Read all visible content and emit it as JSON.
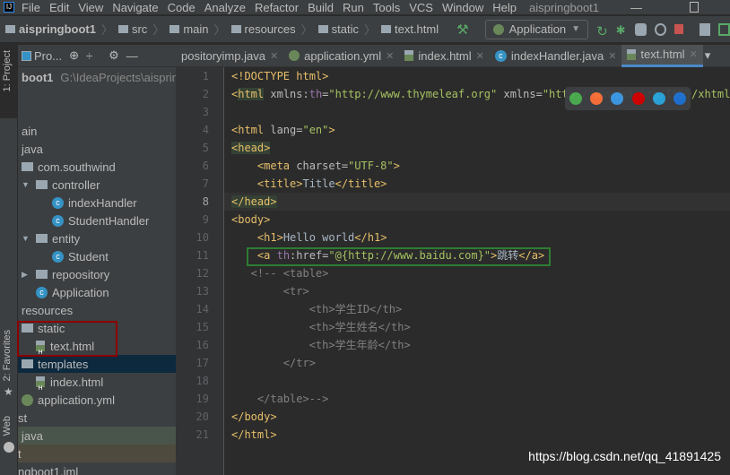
{
  "menubar": {
    "items": [
      "File",
      "Edit",
      "View",
      "Navigate",
      "Code",
      "Analyze",
      "Refactor",
      "Build",
      "Run",
      "Tools",
      "VCS",
      "Window",
      "Help"
    ],
    "title": "aispringboot1"
  },
  "breadcrumb": [
    "aispringboot1",
    "src",
    "main",
    "resources",
    "static",
    "text.html"
  ],
  "run_config": "Application",
  "tabs": [
    {
      "label": "positoryimp.java"
    },
    {
      "label": "application.yml"
    },
    {
      "label": "index.html"
    },
    {
      "label": "indexHandler.java"
    },
    {
      "label": "text.html",
      "active": true
    }
  ],
  "project_panel": {
    "title": "Pro...",
    "path": "G:\\IdeaProjects\\aispring",
    "rows": [
      {
        "label": "boot1",
        "bold": true,
        "indent": 0
      },
      {
        "label": "",
        "indent": 0
      },
      {
        "label": "",
        "indent": 0
      },
      {
        "label": "ain",
        "indent": 0
      },
      {
        "label": "java",
        "indent": 0
      },
      {
        "label": "com.southwind",
        "indent": 0,
        "icon": "package"
      },
      {
        "label": "controller",
        "indent": 1,
        "icon": "package",
        "arrow": "down"
      },
      {
        "label": "indexHandler",
        "indent": 2,
        "icon": "class"
      },
      {
        "label": "StudentHandler",
        "indent": 2,
        "icon": "class"
      },
      {
        "label": "entity",
        "indent": 1,
        "icon": "package",
        "arrow": "down"
      },
      {
        "label": "Student",
        "indent": 2,
        "icon": "class"
      },
      {
        "label": "repoository",
        "indent": 1,
        "icon": "package",
        "arrow": "right"
      },
      {
        "label": "Application",
        "indent": 1,
        "icon": "spring-class"
      },
      {
        "label": "resources",
        "indent": 0
      },
      {
        "label": "static",
        "indent": 0,
        "icon": "folder"
      },
      {
        "label": "text.html",
        "indent": 1,
        "icon": "html"
      },
      {
        "label": "templates",
        "indent": 0,
        "icon": "folder",
        "selected": true
      },
      {
        "label": "index.html",
        "indent": 1,
        "icon": "html"
      },
      {
        "label": "application.yml",
        "indent": 0,
        "icon": "spring"
      },
      {
        "label": "st",
        "indent": -1
      },
      {
        "label": "java",
        "indent": 0,
        "bg": "#49544a"
      },
      {
        "label": "t",
        "indent": -1,
        "bg": "#4e4a3e"
      },
      {
        "label": "ngboot1.iml",
        "indent": -1
      }
    ]
  },
  "side_tabs": {
    "project": "1: Project",
    "favorites": "2: Favorites",
    "web": "Web"
  },
  "editor": {
    "lines": [
      [
        [
          "t",
          "<!DOCTYPE html>"
        ]
      ],
      [
        [
          "t",
          "<"
        ],
        [
          "t hl",
          "html"
        ],
        [
          "a",
          " xmlns:"
        ],
        [
          "n",
          "th"
        ],
        [
          "a",
          "="
        ],
        [
          "s",
          "\"http://www.thymeleaf.org\""
        ],
        [
          "a",
          " xmlns="
        ],
        [
          "s",
          "\"http://www.w3.org/1999/xhtml\""
        ],
        [
          "t",
          ">"
        ]
      ],
      [],
      [
        [
          "t",
          "<html"
        ],
        [
          "a",
          " lang="
        ],
        [
          "s",
          "\"en\""
        ],
        [
          "t",
          ">"
        ]
      ],
      [
        [
          "t hl",
          "<head>"
        ]
      ],
      [
        [
          "x",
          "    "
        ],
        [
          "t",
          "<meta"
        ],
        [
          "a",
          " charset="
        ],
        [
          "s",
          "\"UTF-8\""
        ],
        [
          "t",
          ">"
        ]
      ],
      [
        [
          "x",
          "    "
        ],
        [
          "t",
          "<title>"
        ],
        [
          "x",
          "Title"
        ],
        [
          "t",
          "</title>"
        ]
      ],
      [
        [
          "t hl",
          "</head>"
        ]
      ],
      [
        [
          "t",
          "<body>"
        ]
      ],
      [
        [
          "x",
          "    "
        ],
        [
          "t",
          "<h1>"
        ],
        [
          "x",
          "Hello world"
        ],
        [
          "t",
          "</h1>"
        ]
      ],
      [
        [
          "x",
          "    "
        ],
        [
          "t",
          "<a "
        ],
        [
          "n",
          "th"
        ],
        [
          "a",
          ":href="
        ],
        [
          "s",
          "\"@{http://www.baidu.com}\""
        ],
        [
          "t",
          ">"
        ],
        [
          "x",
          "跳转"
        ],
        [
          "t",
          "</a>"
        ]
      ],
      [
        [
          "c",
          "   <!-- <table>"
        ]
      ],
      [
        [
          "c",
          "        <tr>"
        ]
      ],
      [
        [
          "c",
          "            <th>学生ID</th>"
        ]
      ],
      [
        [
          "c",
          "            <th>学生姓名</th>"
        ]
      ],
      [
        [
          "c",
          "            <th>学生年龄</th>"
        ]
      ],
      [
        [
          "c",
          "        </tr>"
        ]
      ],
      [],
      [
        [
          "c",
          "    </table>-->"
        ]
      ],
      [
        [
          "t",
          "</body>"
        ]
      ],
      [
        [
          "t",
          "</html>"
        ]
      ]
    ]
  },
  "browser_icons": [
    "chrome-icon",
    "firefox-icon",
    "safari-icon",
    "opera-icon",
    "ie-icon",
    "edge-icon"
  ],
  "browser_colors": [
    "#4caf50",
    "#ff7139",
    "#3d9be9",
    "#d50000",
    "#29a8e0",
    "#1e73d6"
  ],
  "watermark": "https://blog.csdn.net/qq_41891425"
}
